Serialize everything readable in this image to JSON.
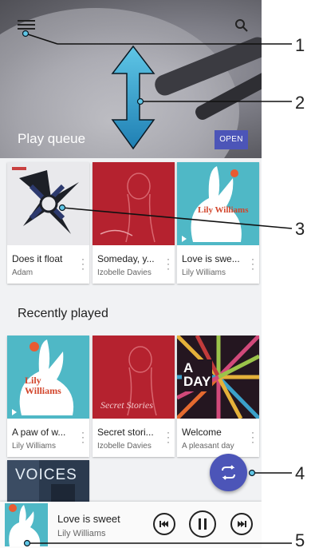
{
  "header": {
    "menu_icon": "hamburger-menu-icon",
    "search_icon": "search-icon",
    "section_title": "Play queue",
    "open_label": "OPEN"
  },
  "play_queue": [
    {
      "title": "Does it float",
      "subtitle": "Adam",
      "art": "adam-cover"
    },
    {
      "title": "Someday, y...",
      "subtitle": "Izobelle Davies",
      "art": "secret-stories-cover"
    },
    {
      "title": "Love is swe...",
      "subtitle": "Lily Williams",
      "art": "lily-williams-cover",
      "art_text": "Lily Williams"
    }
  ],
  "recently_played": {
    "title": "Recently played",
    "items": [
      {
        "title": "A paw of w...",
        "subtitle": "Lily Williams",
        "art": "lily-williams-cover",
        "art_text": "Lily Williams"
      },
      {
        "title": "Secret stori...",
        "subtitle": "Izobelle Davies",
        "art": "secret-stories-cover",
        "art_text": "Secret Stories"
      },
      {
        "title": "Welcome",
        "subtitle": "A pleasant day",
        "art": "a-day-cover",
        "art_text": "A DAY"
      },
      {
        "art": "voices-cover",
        "art_text": "VOICES"
      }
    ]
  },
  "fab": {
    "icon": "shuffle-repeat-icon"
  },
  "player": {
    "song": "Love is sweet",
    "artist": "Lily Williams",
    "controls": [
      "previous-icon",
      "pause-icon",
      "next-icon"
    ]
  },
  "callouts": [
    "1",
    "2",
    "3",
    "4",
    "5"
  ],
  "colors": {
    "accent": "#4c55b8",
    "background": "#f1f2f4"
  }
}
